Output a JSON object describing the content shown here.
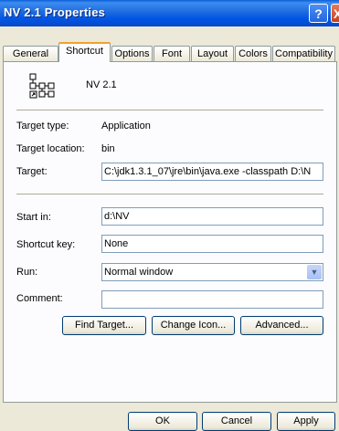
{
  "window": {
    "title": "NV 2.1 Properties",
    "help_glyph": "?",
    "close_glyph": "X"
  },
  "tabs": [
    {
      "label": "General"
    },
    {
      "label": "Shortcut",
      "active": true
    },
    {
      "label": "Options"
    },
    {
      "label": "Font"
    },
    {
      "label": "Layout"
    },
    {
      "label": "Colors"
    },
    {
      "label": "Compatibility"
    }
  ],
  "header": {
    "app_name": "NV 2.1",
    "icon": "shortcut-program-icon"
  },
  "info": {
    "target_type_label": "Target type:",
    "target_type_value": "Application",
    "target_location_label": "Target location:",
    "target_location_value": "bin"
  },
  "fields": {
    "target_label": "Target:",
    "target_value": "C:\\jdk1.3.1_07\\jre\\bin\\java.exe -classpath D:\\N",
    "start_in_label": "Start in:",
    "start_in_value": "d:\\NV",
    "shortcut_key_label": "Shortcut key:",
    "shortcut_key_value": "None",
    "run_label": "Run:",
    "run_value": "Normal window",
    "comment_label": "Comment:",
    "comment_value": ""
  },
  "actions": {
    "find_target": "Find Target...",
    "change_icon": "Change Icon...",
    "advanced": "Advanced..."
  },
  "footer": {
    "ok": "OK",
    "cancel": "Cancel",
    "apply": "Apply"
  },
  "colors": {
    "titlebar": "#0055e5",
    "dialog_bg": "#ece9d8",
    "active_tab_accent": "#f0a030"
  }
}
